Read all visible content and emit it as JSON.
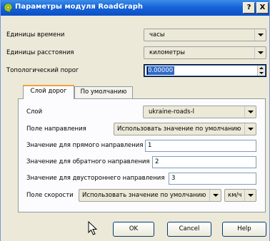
{
  "window": {
    "title": "Параметры модуля RoadGraph",
    "help_label": "?",
    "close_label": "X"
  },
  "general": {
    "time_units_label": "Единицы времени",
    "time_units_value": "часы",
    "distance_units_label": "Единицы расстояния",
    "distance_units_value": "километры",
    "topology_tolerance_label": "Топологический порог",
    "topology_tolerance_value": "0.00000"
  },
  "tabs": {
    "road_layer": "Слой дорог",
    "default": "По умолчанию"
  },
  "road_layer": {
    "layer_label": "Слой",
    "layer_value": "ukraine-roads-l",
    "direction_field_label": "Поле направления",
    "direction_field_value": "Использовать значение по умолчанию",
    "forward_label": "Значение для прямого направления",
    "forward_value": "1",
    "reverse_label": "Значение для обратного направления",
    "reverse_value": "2",
    "both_label": "Значение для двустороннего направления",
    "both_value": "3",
    "speed_field_label": "Поле скорости",
    "speed_field_value": "Использовать значение по умолчанию",
    "speed_unit_value": "км/ч"
  },
  "buttons": {
    "ok": "OK",
    "cancel": "Cancel",
    "help": "Help"
  },
  "colors": {
    "titlebar": "#0b4fc8",
    "selection": "#316ac5",
    "tab_accent": "#f2a23c"
  },
  "icons": {
    "app": "qgis-icon",
    "cursor": "mouse-pointer-icon"
  }
}
